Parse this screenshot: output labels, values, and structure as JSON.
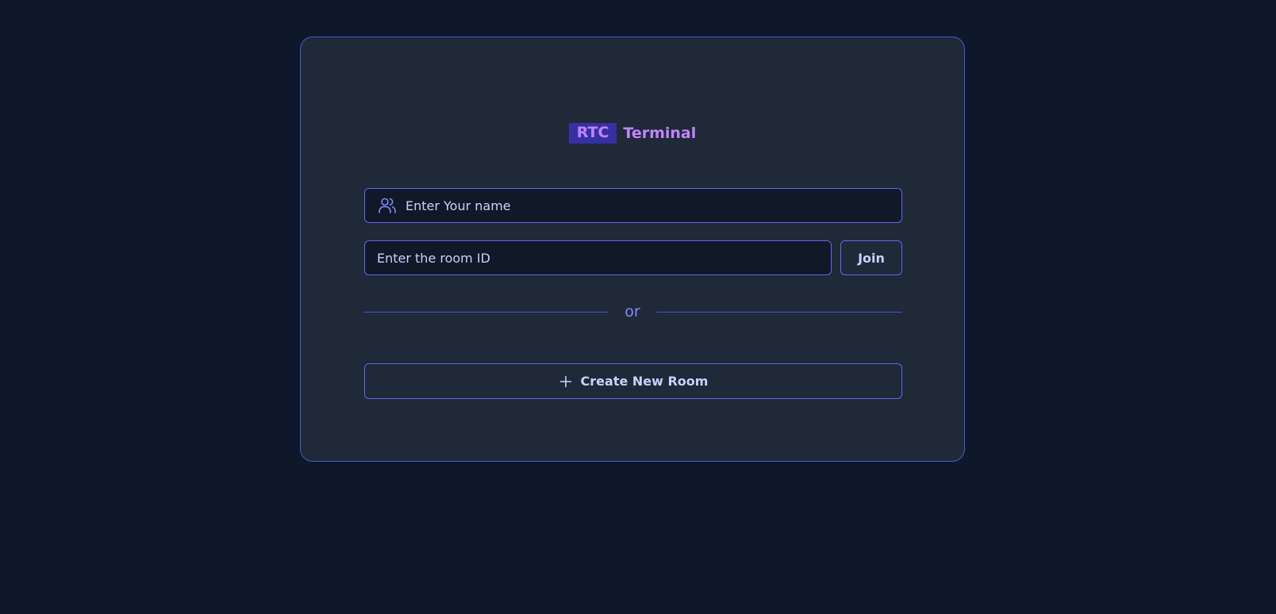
{
  "logo": {
    "badge": "RTC",
    "text": "Terminal"
  },
  "form": {
    "name_placeholder": "Enter Your name",
    "room_placeholder": "Enter the room ID",
    "join_label": "Join",
    "divider_text": "or",
    "create_label": "Create New Room"
  },
  "icons": {
    "name_field": "users-icon",
    "create_button": "plus-icon"
  },
  "colors": {
    "background": "#0f172a",
    "card": "#1f2937",
    "input_background": "#111827",
    "accent_border": "#6366f1",
    "logo_badge": "#3730a3",
    "logo_text": "#c084fc",
    "text": "#c7d2fe",
    "divider_text": "#818cf8"
  }
}
